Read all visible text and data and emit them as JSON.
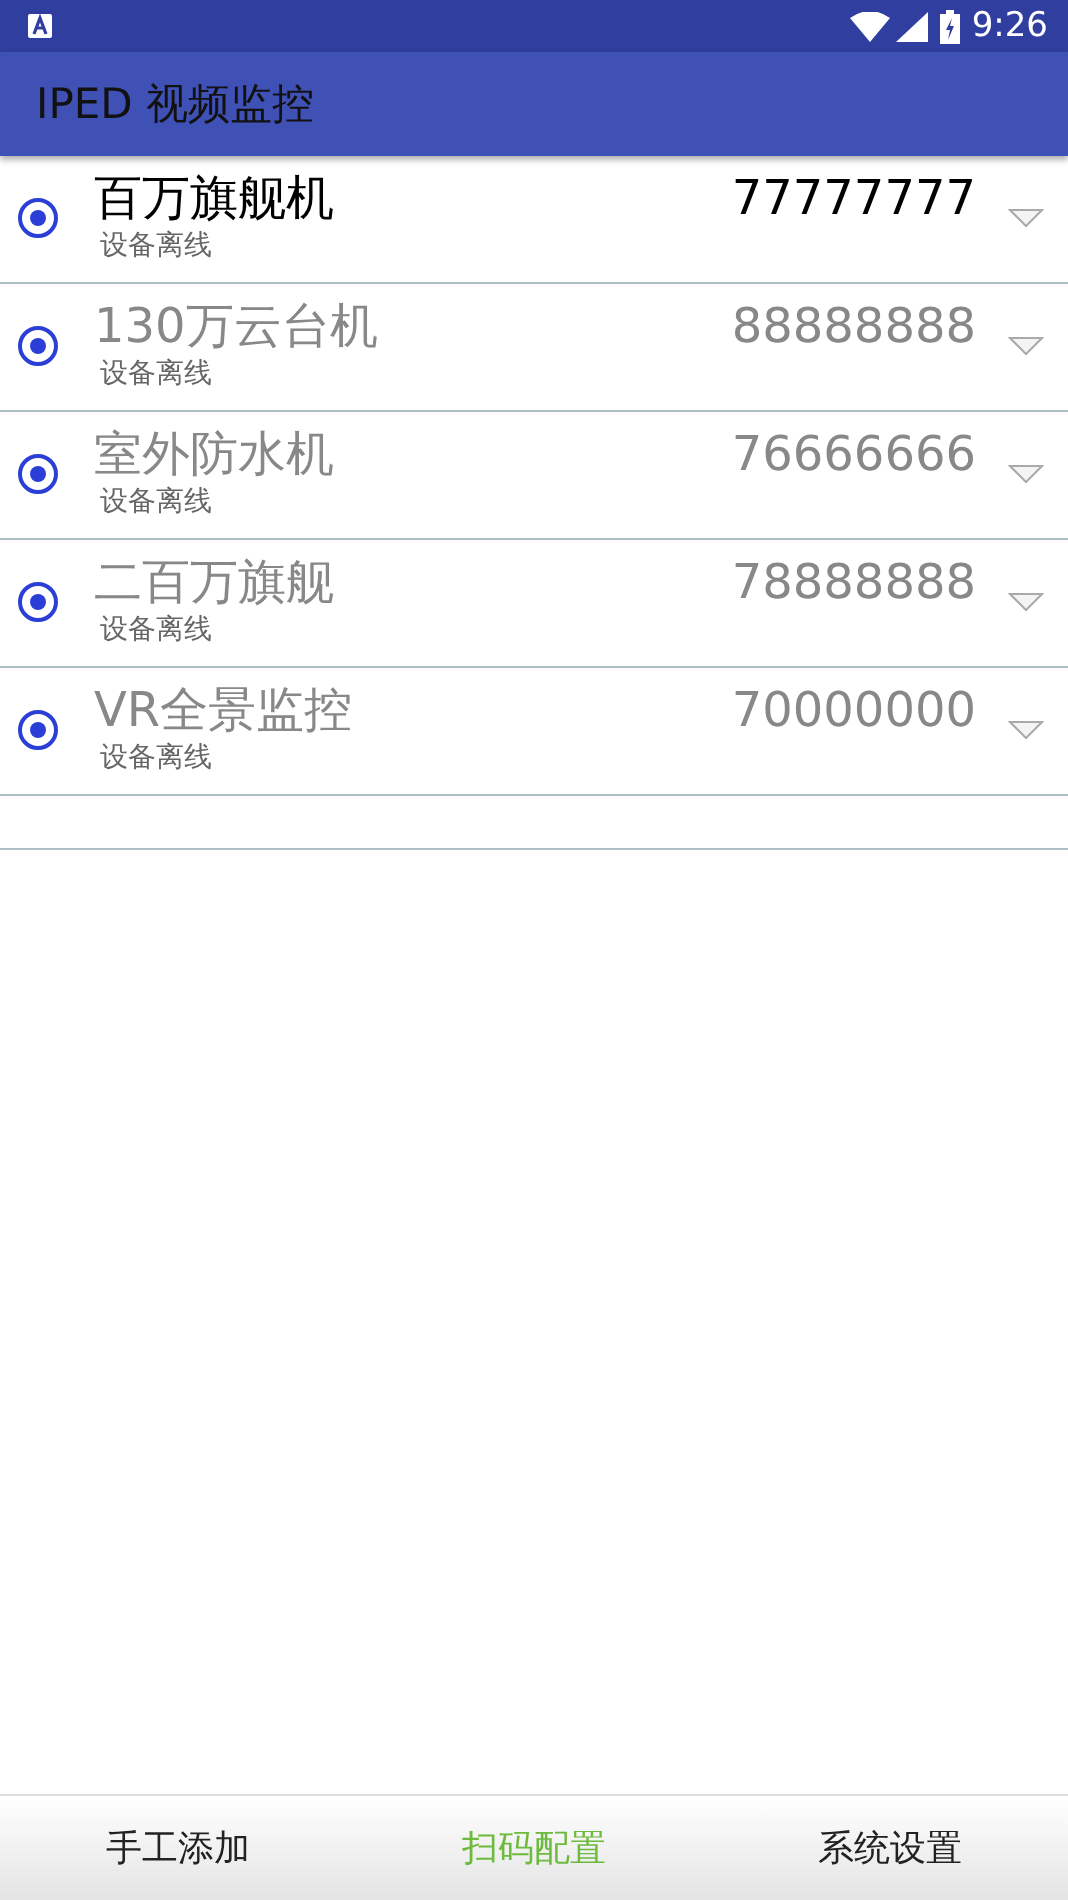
{
  "status_bar": {
    "time": "9:26"
  },
  "app_bar": {
    "title": "IPED 视频监控"
  },
  "devices": [
    {
      "name": "百万旗舰机",
      "number": "77777777",
      "status": "设备离线",
      "selected": true,
      "checked": true
    },
    {
      "name": "130万云台机",
      "number": "88888888",
      "status": "设备离线",
      "selected": false,
      "checked": true
    },
    {
      "name": "室外防水机",
      "number": "76666666",
      "status": "设备离线",
      "selected": false,
      "checked": true
    },
    {
      "name": "二百万旗舰",
      "number": "78888888",
      "status": "设备离线",
      "selected": false,
      "checked": true
    },
    {
      "name": "VR全景监控",
      "number": "70000000",
      "status": "设备离线",
      "selected": false,
      "checked": true
    }
  ],
  "bottom_tabs": [
    {
      "label": "手工添加",
      "selected": false
    },
    {
      "label": "扫码配置",
      "selected": true
    },
    {
      "label": "系统设置",
      "selected": false
    }
  ]
}
